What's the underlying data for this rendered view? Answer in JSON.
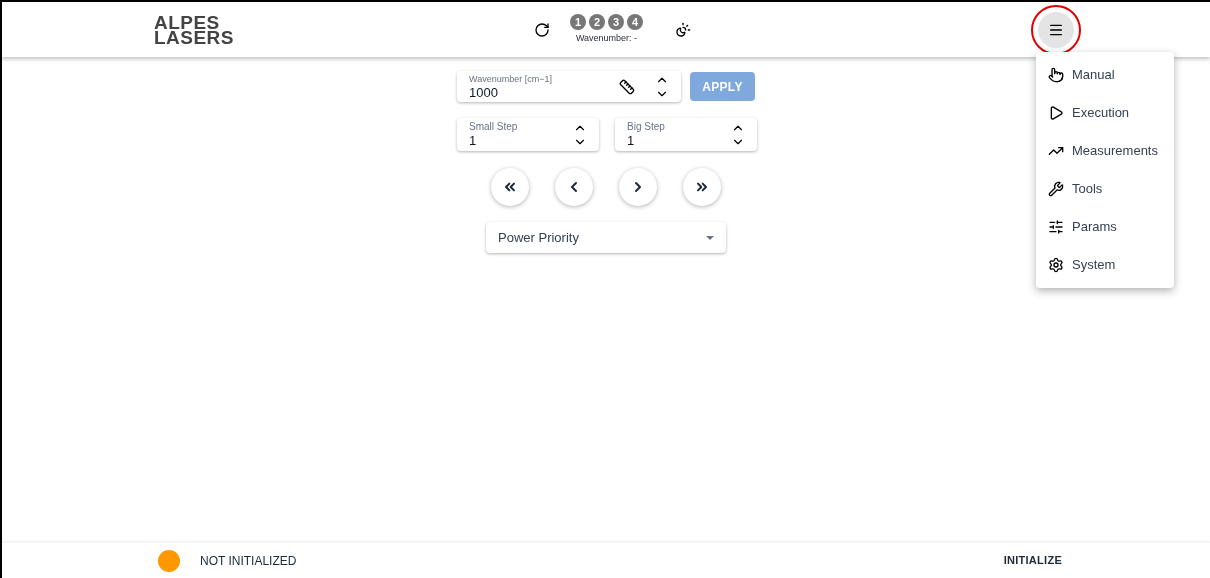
{
  "header": {
    "logo": [
      "ALPES",
      "LASERS"
    ],
    "channels": [
      "1",
      "2",
      "3",
      "4"
    ],
    "wavenumber_label": "Wavenumber: -"
  },
  "form": {
    "wavenumber": {
      "label": "Wavenumber [cm−1]",
      "value": "1000"
    },
    "apply": {
      "label": "APPLY",
      "disabled": true
    },
    "small_step": {
      "label": "Small Step",
      "value": "1"
    },
    "big_step": {
      "label": "Big Step",
      "value": "1"
    },
    "step_buttons": [
      {
        "kind": "fast-back"
      },
      {
        "kind": "back"
      },
      {
        "kind": "forward"
      },
      {
        "kind": "fast-forward"
      }
    ],
    "mode_select": {
      "value": "Power Priority"
    }
  },
  "menu": {
    "open": true,
    "items": [
      {
        "kind": "manual",
        "label": "Manual"
      },
      {
        "kind": "execution",
        "label": "Execution"
      },
      {
        "kind": "measurements",
        "label": "Measurements"
      },
      {
        "kind": "tools",
        "label": "Tools"
      },
      {
        "kind": "params",
        "label": "Params"
      },
      {
        "kind": "system",
        "label": "System"
      }
    ]
  },
  "status_bar": {
    "status": "NOT INITIALIZED",
    "color": "#ff9800",
    "action": "INITIALIZE"
  }
}
